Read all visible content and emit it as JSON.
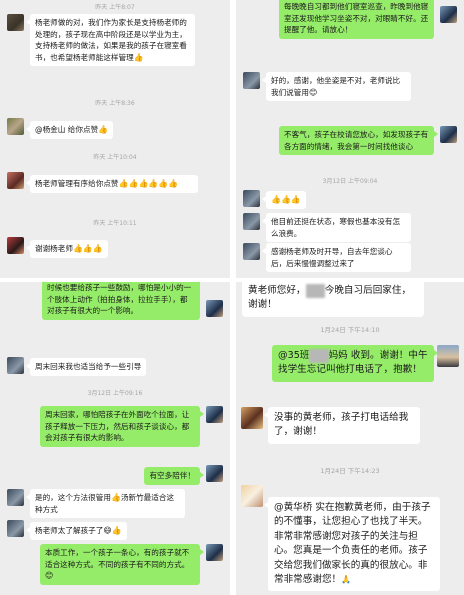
{
  "colors": {
    "chat_bg": "#ededed",
    "sent_bubble": "#95ec69",
    "received_bubble": "#ffffff",
    "timestamp": "#a5a5a5"
  },
  "panel1": {
    "t0": "昨天 上午8:07",
    "m1": "杨老师做的对，我们作为家长是支持杨老师的处理的，孩子现在高中阶段还是以学业为主，支持杨老师的做法，如果是我的孩子在寝室看书，也希望杨老师能这样管理",
    "m1_emoji": "👍",
    "t1": "昨天 上午8:36",
    "m2": "@杨金山  给你点赞",
    "m2_emoji": "👍",
    "t2": "昨天 上午10:04",
    "m3": "杨老师管理有序给你点赞",
    "m3_emoji": "👍👍👍👍👍👍",
    "t3": "昨天 上午10:11",
    "m4": "谢谢杨老师",
    "m4_emoji": "👍👍👍"
  },
  "panel2": {
    "m1": "每晚晚自习都到他们寝室巡查，昨晚到他寝室还发现他学习坐姿不对，对眼睛不好。还提醒了他。请放心！",
    "m2": "好的，感谢，他坐姿是不对，老师说比我们说管用",
    "m2_emoji": "😊",
    "m3": "不客气，孩子在校请您放心，如发现孩子有各方面的情绪，我会第一时间找他谈心",
    "t1": "3月12日 上午09:04",
    "m4_emoji": "👍👍👍",
    "m5": "他目前还挺在状态，寒假也基本没有怎么浪费。",
    "m6": "感谢杨老师及时开导，自去年您谈心后，后来慢慢调整过来了"
  },
  "panel3": {
    "m1": "时候也要给孩子一些鼓励，哪怕是小小的一个肢体上动作（拍拍身体，拉拉手手），都对孩子有很大的一个影响。",
    "m2": "周末回来我也适当给予一些引导",
    "t1": "3月12日 上午09:16",
    "m3": "周末回家，哪怕陪孩子在外面吃个拉面，让孩子释放一下压力，然后和孩子谈谈心，都会对孩子有很大的影响。",
    "m4": "有空多陪伴！",
    "m5": "是的，这个方法很管用",
    "m5_emoji": "👍",
    "m5_tail": "汤新竹最适合这种方式",
    "m6": "杨老师太了解孩子了",
    "m6_emoji": "😄👍",
    "m7": "本质工作，一个孩子一条心，有的孩子就不适合这种方式。不同的孩子有不同的方式。",
    "m7_emoji": "😊"
  },
  "panel4": {
    "m1_pre": "黄老师您好，",
    "m1_post": "今晚自习后回家住，谢谢！",
    "t1": "1月24日 下午14:10",
    "m2_pre": "@35班",
    "m2_mid": "妈妈  收到。谢谢！中午找学生忘记叫他打电话了，抱歉！",
    "m3": "没事的黄老师，孩子打电话给我了，谢谢！",
    "t2": "1月24日 下午14:23",
    "m4": "@黄华桥  实在抱歉黄老师，由于孩子的不懂事，让您担心了也找了半天。非常非常感谢您对孩子的关注与担心。您真是一个负责任的老师。孩子交给您我们做家长的真的很放心。非常非常感谢您！",
    "m4_emoji": "🙏"
  }
}
